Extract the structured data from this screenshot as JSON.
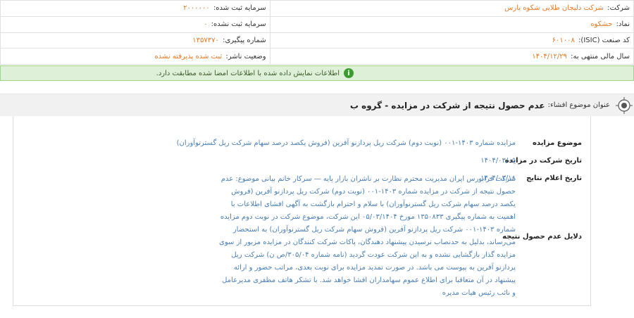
{
  "company_info": {
    "company_label": "شرکت:",
    "company_value": "شرکت دلیجان طلایی شکوه پارس",
    "capital_registered_label": "سرمایه ثبت شده:",
    "capital_registered_value": "۲۰۰۰۰۰۰",
    "symbol_label": "نماد:",
    "symbol_value": "حشکوه",
    "capital_unregistered_label": "سرمایه ثبت نشده:",
    "capital_unregistered_value": "۰",
    "isic_label": "کد صنعت (ISIC):",
    "isic_value": "۶۰۱۰۰۸",
    "tracking_label": "شماره پیگیری:",
    "tracking_value": "۱۳۵۷۳۷۰",
    "fiscal_label": "سال مالی منتهی به:",
    "fiscal_value": "۱۴۰۴/۱۲/۲۹",
    "publisher_status_label": "وضعیت ناشر:",
    "publisher_status_value": "ثبت شده پذیرفته نشده"
  },
  "message": {
    "text": "اطلاعات نمایش داده شده با اطلاعات امضا شده مطابقت دارد.",
    "icon": "info-icon",
    "colors": {
      "background": "#dff0d8",
      "border": "#9fd48a",
      "icon": "#3d9b2f"
    }
  },
  "subject": {
    "label": "عنوان موضوع افشاء:",
    "value": "عدم حصول نتیجه از شرکت در مزایده - گروه ب"
  },
  "details": [
    {
      "key": "موضوع مزایده",
      "value": "مزایده شماره ۱۴۰۳-۰۰۱ (نوبت دوم) شرکت ریل پردازنو آفرین (فروش یکصد درصد سهام شرکت ریل گسترنوآوران)"
    },
    {
      "key": "تاریخ شرکت در مزایده",
      "value": "۱۴۰۴/۰۳/۰۵"
    },
    {
      "key": "تاریخ اعلام نتایج",
      "value": "۱۴۰۴/۰۳/۱۸"
    },
    {
      "key": "دلایل عدم حصول نتیجه",
      "value": "شرکت فرابورس ایران مدیریت محترم نظارت بر ناشران بازار پایه — سرکار خانم بیانی موضوع: عدم حصول نتیجه از شرکت در مزایده شماره ۱۴۰۳-۰۰۱ (نوبت دوم) شرکت ریل پردازنو آفرین (فروش یکصد درصد سهام شرکت ریل گسترنوآوران) با سلام و احترام بازگشت به آگهی افشای اطلاعات با اهمیت به شماره پیگیری ۱۳۵۰۸۳۳ مورخ ۰۵/۰۳/۱۴۰۴ این شرکت، موضوع شرکت در نوبت دوم مزایده شماره ۱۴۰۳-۰۰۱ شرکت ریل پردازنو آفرین (فروش سهام شرکت ریل گسترنوآوران) به استحضار می‌رساند، بدلیل به حدنصاب نرسیدن پیشنهاد دهندگان، پاکات شرکت کنندگان در مزایده مزبور از سوی مزایده گذار بازگشایی نشده و به این شرکت عودت گردید (نامه شماره ۳۰۵/۰۴/ص ن) شرکت ریل پردازنو آفرین به پیوست می باشد. در صورت تمدید مزایده برای نوبت بعدی، مراتب حضور و ارائه پیشنهاد در آن متعاقبا برای اطلاع عموم سهامداران افشا خواهد شد. با تشکر هاتف مظفری مدیرعامل و نائب رئیس هیات مدیره"
    }
  ],
  "colors": {
    "accent_orange": "#e87722",
    "link_blue": "#4a7fb5",
    "header_bg": "#f1f1f1"
  }
}
